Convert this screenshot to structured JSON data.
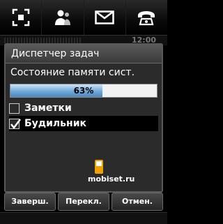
{
  "topbar": {
    "icons": [
      "scan-frame-icon",
      "contacts-icon",
      "envelope-icon",
      "phone-icon"
    ]
  },
  "status": {
    "time": "12:00"
  },
  "dialog": {
    "title": "Диспетчер задач",
    "memory_label": "Состояние памяти сист.",
    "memory_percent": 63,
    "memory_percent_text": "63%",
    "tasks": [
      {
        "label": "Заметки",
        "checked": false
      },
      {
        "label": "Будильник",
        "checked": true
      }
    ]
  },
  "watermark": "mobiset.ru",
  "softkeys": {
    "end": "Заверш.",
    "switch": "Перекл.",
    "cancel": "Отмен."
  },
  "colors": {
    "progress_fill": "#6ea9d9",
    "dialog_bg": "#2b2b2b",
    "watermark_logo": "#f0a000"
  }
}
